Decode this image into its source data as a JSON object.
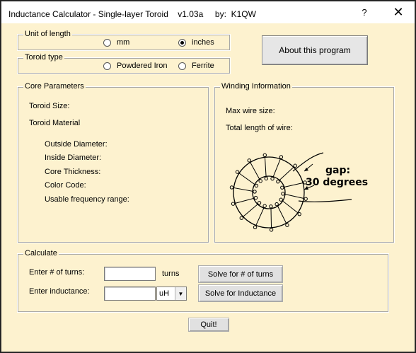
{
  "window": {
    "title": "Inductance Calculator - Single-layer Toroid    v1.03a     by:  K1QW",
    "help_label": "?",
    "close_label": "✕"
  },
  "unit_of_length": {
    "legend": "Unit of length",
    "options": [
      {
        "label": "mm",
        "selected": false
      },
      {
        "label": "inches",
        "selected": true
      }
    ]
  },
  "toroid_type": {
    "legend": "Toroid type",
    "options": [
      {
        "label": "Powdered Iron",
        "selected": false
      },
      {
        "label": "Ferrite",
        "selected": false
      }
    ]
  },
  "about_button": "About this program",
  "core_parameters": {
    "legend": "Core Parameters",
    "toroid_size": "Toroid Size:",
    "toroid_material": "Toroid Material",
    "outside_diameter": "Outside Diameter:",
    "inside_diameter": "Inside Diameter:",
    "core_thickness": "Core Thickness:",
    "color_code": "Color Code:",
    "frequency_range": "Usable frequency range:"
  },
  "winding_information": {
    "legend": "Winding Information",
    "max_wire_size": "Max wire size:",
    "total_length": "Total length of wire:",
    "diagram_gap_label": "gap:",
    "diagram_degrees_label": "30 degrees"
  },
  "calculate": {
    "legend": "Calculate",
    "turns_label": "Enter # of turns:",
    "turns_value": "",
    "turns_unit": "turns",
    "inductance_label": "Enter inductance:",
    "inductance_value": "",
    "inductance_unit": "uH",
    "solve_turns_button": "Solve for # of turns",
    "solve_inductance_button": "Solve for Inductance"
  },
  "quit_button": "Quit!"
}
